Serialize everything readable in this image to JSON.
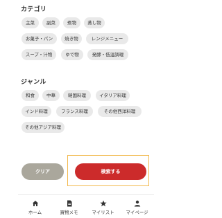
{
  "category": {
    "title": "カテゴリ",
    "chips": [
      "主菜",
      "副菜",
      "煮物",
      "蒸し物",
      "お菓子・パン",
      "焼き物",
      "レンジメニュー",
      "スープ・汁物",
      "ゆで物",
      "発酵・低温調理"
    ]
  },
  "genre": {
    "title": "ジャンル",
    "chips": [
      "和食",
      "中華",
      "韓国料理",
      "イタリア料理",
      "インド料理",
      "フランス料理",
      "その他西洋料理",
      "その他アジア料理"
    ]
  },
  "actions": {
    "clear_label": "クリア",
    "search_label": "検索する"
  },
  "tabbar": {
    "items": [
      {
        "label": "ホーム",
        "icon": "home-icon"
      },
      {
        "label": "買物メモ",
        "icon": "memo-icon"
      },
      {
        "label": "マイリスト",
        "icon": "star-icon"
      },
      {
        "label": "マイページ",
        "icon": "person-icon"
      }
    ]
  },
  "colors": {
    "accent": "#cc2b2b",
    "clear": "#aaa79c",
    "chip": "#e9e9e9",
    "highlight": "#f2b84b"
  }
}
